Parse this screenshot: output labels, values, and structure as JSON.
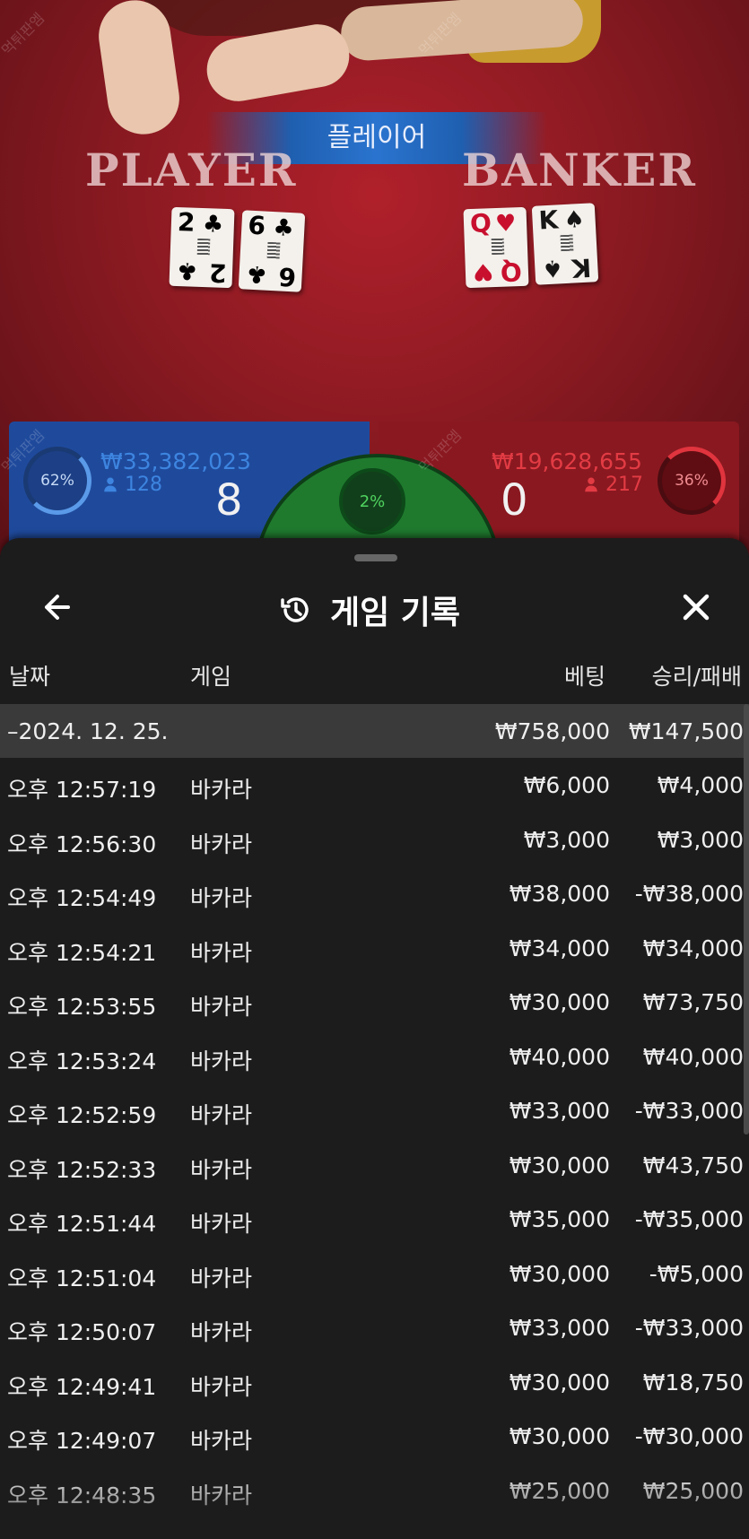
{
  "game": {
    "result_banner": "플레이어",
    "player_label": "PLAYER",
    "banker_label": "BANKER",
    "player_cards": [
      {
        "rank": "2",
        "suit": "♣",
        "color": "black"
      },
      {
        "rank": "6",
        "suit": "♣",
        "color": "black"
      }
    ],
    "banker_cards": [
      {
        "rank": "Q",
        "suit": "♥",
        "color": "red"
      },
      {
        "rank": "K",
        "suit": "♠",
        "color": "black"
      }
    ],
    "player_stats": {
      "percent": "62%",
      "amount": "₩33,382,023",
      "count": "128",
      "score": "8"
    },
    "banker_stats": {
      "percent": "36%",
      "amount": "₩19,628,655",
      "count": "217",
      "score": "0"
    },
    "tie_percent": "2%",
    "watermark": "먹튀판엠"
  },
  "history": {
    "title": "게임 기록",
    "icons": {
      "back": "arrow-left-icon",
      "title": "history-icon",
      "close": "close-icon",
      "user": "user-icon"
    },
    "columns": {
      "date": "날짜",
      "game": "게임",
      "bet": "베팅",
      "win_loss": "승리/패배"
    },
    "summary": {
      "date": "–2024. 12. 25.",
      "bet": "₩758,000",
      "win_loss": "₩147,500"
    },
    "rows": [
      {
        "time": "오후 12:57:19",
        "game": "바카라",
        "bet": "₩6,000",
        "result": "₩4,000"
      },
      {
        "time": "오후 12:56:30",
        "game": "바카라",
        "bet": "₩3,000",
        "result": "₩3,000"
      },
      {
        "time": "오후 12:54:49",
        "game": "바카라",
        "bet": "₩38,000",
        "result": "-₩38,000"
      },
      {
        "time": "오후 12:54:21",
        "game": "바카라",
        "bet": "₩34,000",
        "result": "₩34,000"
      },
      {
        "time": "오후 12:53:55",
        "game": "바카라",
        "bet": "₩30,000",
        "result": "₩73,750"
      },
      {
        "time": "오후 12:53:24",
        "game": "바카라",
        "bet": "₩40,000",
        "result": "₩40,000"
      },
      {
        "time": "오후 12:52:59",
        "game": "바카라",
        "bet": "₩33,000",
        "result": "-₩33,000"
      },
      {
        "time": "오후 12:52:33",
        "game": "바카라",
        "bet": "₩30,000",
        "result": "₩43,750"
      },
      {
        "time": "오후 12:51:44",
        "game": "바카라",
        "bet": "₩35,000",
        "result": "-₩35,000"
      },
      {
        "time": "오후 12:51:04",
        "game": "바카라",
        "bet": "₩30,000",
        "result": "-₩5,000"
      },
      {
        "time": "오후 12:50:07",
        "game": "바카라",
        "bet": "₩33,000",
        "result": "-₩33,000"
      },
      {
        "time": "오후 12:49:41",
        "game": "바카라",
        "bet": "₩30,000",
        "result": "₩18,750"
      },
      {
        "time": "오후 12:49:07",
        "game": "바카라",
        "bet": "₩30,000",
        "result": "-₩30,000"
      },
      {
        "time": "오후 12:48:35",
        "game": "바카라",
        "bet": "₩25,000",
        "result": "₩25,000"
      }
    ]
  }
}
